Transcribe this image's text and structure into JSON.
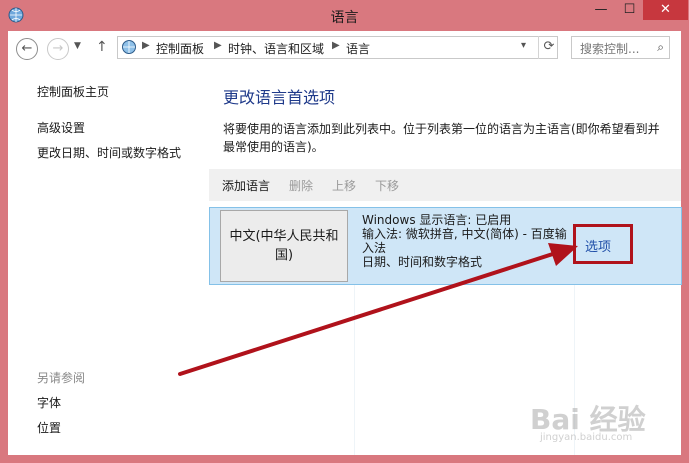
{
  "window": {
    "title": "语言",
    "minimize": "—",
    "maximize": "☐",
    "close": "✕"
  },
  "nav": {
    "back": "←",
    "forward": "→",
    "dropdown": "▼",
    "up": "↑",
    "breadcrumbs": [
      "控制面板",
      "时钟、语言和区域",
      "语言"
    ],
    "separator": "▶",
    "refresh": "⟳",
    "search_placeholder": "搜索控制...",
    "search_icon": "⌕"
  },
  "sidebar": {
    "home": "控制面板主页",
    "advanced": "高级设置",
    "datetime": "更改日期、时间或数字格式",
    "see_also": "另请参阅",
    "fonts": "字体",
    "location": "位置"
  },
  "main": {
    "heading": "更改语言首选项",
    "description": "将要使用的语言添加到此列表中。位于列表第一位的语言为主语言(即你希望看到并最常使用的语言)。",
    "toolbar": {
      "add": "添加语言",
      "remove": "删除",
      "move_up": "上移",
      "move_down": "下移"
    },
    "language": {
      "name": "中文(中华人民共和国)",
      "info": [
        "Windows 显示语言: 已启用",
        "输入法: 微软拼音, 中文(简体) - 百度输入法",
        "日期、时间和数字格式"
      ],
      "options": "选项"
    }
  },
  "colors": {
    "accent": "#1f3a8a",
    "highlight_box": "#b0121b",
    "selection": "#cfe6f7",
    "frame": "#d9787f"
  },
  "watermark": {
    "brand": "Bai 经验",
    "site": "jingyan.baidu.com"
  }
}
